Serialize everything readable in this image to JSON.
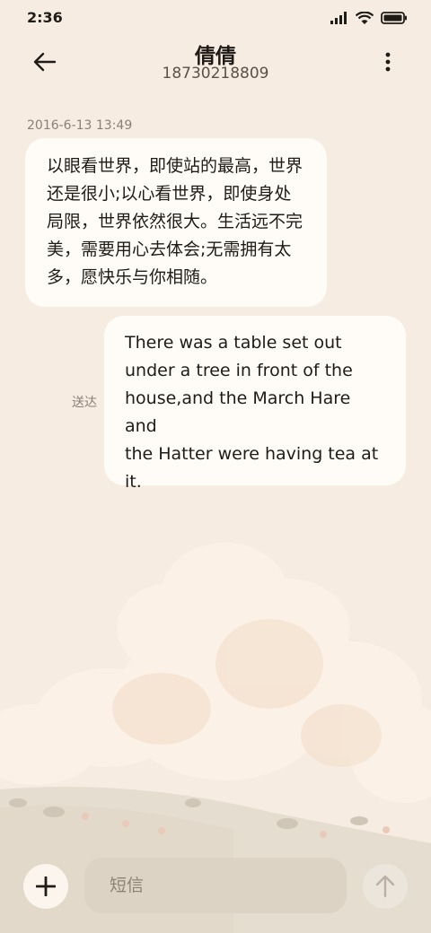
{
  "status_bar": {
    "time": "2:36",
    "icons": [
      "signal-icon",
      "wifi-icon",
      "battery-icon"
    ]
  },
  "header": {
    "contact_name": "倩倩",
    "contact_number": "18730218809",
    "back_icon": "arrow-left-icon",
    "more_icon": "more-vertical-icon"
  },
  "conversation": {
    "timestamp": "2016-6-13 13:49",
    "messages": [
      {
        "direction": "incoming",
        "lines": [
          "以眼看世界，即使站的最高，世界",
          "还是很小;以心看世界，即使身处",
          "局限，世界依然很大。生活远不完",
          "美，需要用心去体会;无需拥有太",
          "多，愿快乐与你相随。"
        ]
      },
      {
        "direction": "outgoing",
        "status": "送达",
        "lines": [
          "There was a table set out",
          "under a tree in front of the",
          "house,and the March Hare and",
          "the Hatter were having tea at",
          "it."
        ]
      }
    ]
  },
  "composer": {
    "placeholder": "短信",
    "add_icon": "plus-icon",
    "send_icon": "arrow-up-icon"
  },
  "colors": {
    "background": "#f6ece2",
    "bubble": "#fffcf8",
    "input": "#ddd3c5",
    "muted_text": "#8a8078"
  }
}
